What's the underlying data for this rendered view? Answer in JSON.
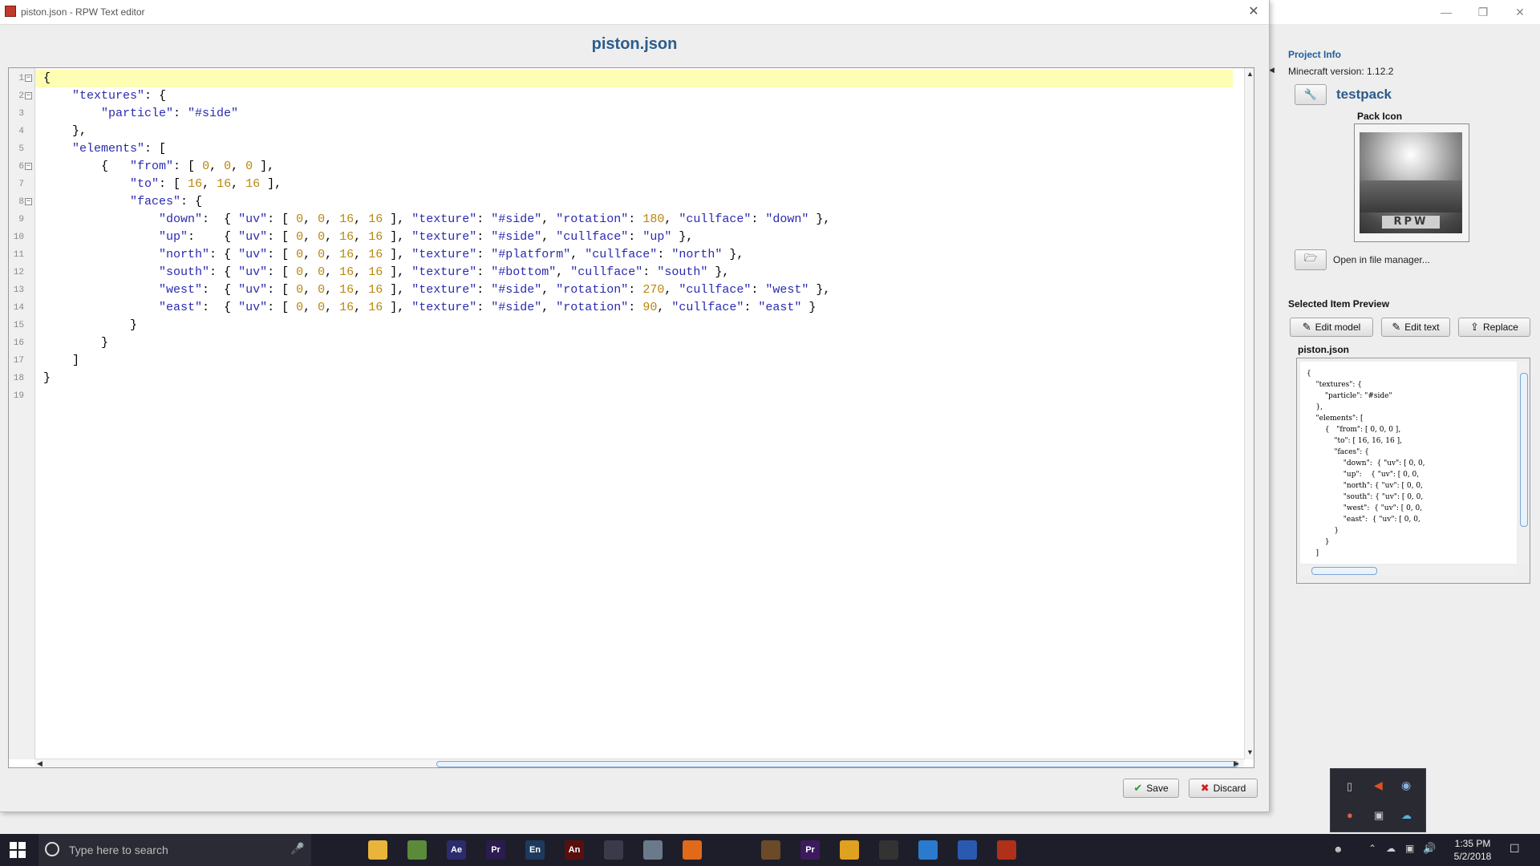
{
  "dialog": {
    "window_title": "piston.json - RPW Text editor",
    "file_name": "piston.json",
    "save_label": "Save",
    "discard_label": "Discard"
  },
  "editor": {
    "lines": [
      {
        "n": "1",
        "fold": true,
        "text": "{"
      },
      {
        "n": "2",
        "fold": true,
        "text": "    \"textures\": {"
      },
      {
        "n": "3",
        "fold": false,
        "text": "        \"particle\": \"#side\""
      },
      {
        "n": "4",
        "fold": false,
        "text": "    },"
      },
      {
        "n": "5",
        "fold": false,
        "text": "    \"elements\": ["
      },
      {
        "n": "6",
        "fold": true,
        "text": "        {   \"from\": [ 0, 0, 0 ],"
      },
      {
        "n": "7",
        "fold": false,
        "text": "            \"to\": [ 16, 16, 16 ],"
      },
      {
        "n": "8",
        "fold": true,
        "text": "            \"faces\": {"
      },
      {
        "n": "9",
        "fold": false,
        "text": "                \"down\":  { \"uv\": [ 0, 0, 16, 16 ], \"texture\": \"#side\", \"rotation\": 180, \"cullface\": \"down\" },"
      },
      {
        "n": "10",
        "fold": false,
        "text": "                \"up\":    { \"uv\": [ 0, 0, 16, 16 ], \"texture\": \"#side\", \"cullface\": \"up\" },"
      },
      {
        "n": "11",
        "fold": false,
        "text": "                \"north\": { \"uv\": [ 0, 0, 16, 16 ], \"texture\": \"#platform\", \"cullface\": \"north\" },"
      },
      {
        "n": "12",
        "fold": false,
        "text": "                \"south\": { \"uv\": [ 0, 0, 16, 16 ], \"texture\": \"#bottom\", \"cullface\": \"south\" },"
      },
      {
        "n": "13",
        "fold": false,
        "text": "                \"west\":  { \"uv\": [ 0, 0, 16, 16 ], \"texture\": \"#side\", \"rotation\": 270, \"cullface\": \"west\" },"
      },
      {
        "n": "14",
        "fold": false,
        "text": "                \"east\":  { \"uv\": [ 0, 0, 16, 16 ], \"texture\": \"#side\", \"rotation\": 90, \"cullface\": \"east\" }"
      },
      {
        "n": "15",
        "fold": false,
        "text": "            }"
      },
      {
        "n": "16",
        "fold": false,
        "text": "        }"
      },
      {
        "n": "17",
        "fold": false,
        "text": "    ]"
      },
      {
        "n": "18",
        "fold": false,
        "text": "}"
      },
      {
        "n": "19",
        "fold": false,
        "text": ""
      }
    ],
    "active_line": "1"
  },
  "project": {
    "heading": "Project Info",
    "mc_version": "Minecraft version: 1.12.2",
    "pack_name": "testpack",
    "pack_icon_label": "Pack Icon",
    "pack_icon_text": "RPW",
    "open_in_fm": "Open in file manager...",
    "preview_heading": "Selected Item Preview",
    "edit_model": "Edit model",
    "edit_text": "Edit text",
    "replace": "Replace",
    "preview_file": "piston.json",
    "preview_lines": [
      "{",
      "    \"textures\": {",
      "        \"particle\": \"#side\"",
      "    },",
      "    \"elements\": [",
      "        {   \"from\": [ 0, 0, 0 ],",
      "            \"to\": [ 16, 16, 16 ],",
      "            \"faces\": {",
      "                \"down\":  { \"uv\": [ 0, 0,",
      "                \"up\":    { \"uv\": [ 0, 0,",
      "                \"north\": { \"uv\": [ 0, 0,",
      "                \"south\": { \"uv\": [ 0, 0,",
      "                \"west\":  { \"uv\": [ 0, 0,",
      "                \"east\":  { \"uv\": [ 0, 0,",
      "            }",
      "        }",
      "    ]"
    ]
  },
  "taskbar": {
    "search_placeholder": "Type here to search",
    "time": "1:35 PM",
    "date": "5/2/2018",
    "apps": [
      {
        "name": "task-view",
        "label": "",
        "color": "#1e1e2a"
      },
      {
        "name": "file-explorer",
        "label": "",
        "color": "#e8b53a"
      },
      {
        "name": "minecraft",
        "label": "",
        "color": "#5b8a3a"
      },
      {
        "name": "after-effects",
        "label": "Ae",
        "color": "#2b2b6e"
      },
      {
        "name": "premiere-pro",
        "label": "Pr",
        "color": "#2b1b4e"
      },
      {
        "name": "encore",
        "label": "En",
        "color": "#1d3a5e"
      },
      {
        "name": "animate",
        "label": "An",
        "color": "#5a0f0f"
      },
      {
        "name": "film-editor",
        "label": "",
        "color": "#3a3a4a"
      },
      {
        "name": "photo-viewer",
        "label": "",
        "color": "#6a7a8a"
      },
      {
        "name": "firefox",
        "label": "",
        "color": "#e06a1a"
      },
      {
        "name": "monitor-app",
        "label": "",
        "color": "#1e1e2a"
      },
      {
        "name": "game-app",
        "label": "",
        "color": "#6b4a2a"
      },
      {
        "name": "premiere-rush",
        "label": "Pr",
        "color": "#3d1a5e"
      },
      {
        "name": "fl-studio",
        "label": "",
        "color": "#e0a020"
      },
      {
        "name": "obs",
        "label": "",
        "color": "#333"
      },
      {
        "name": "chat-app",
        "label": "",
        "color": "#2a7ad0"
      },
      {
        "name": "notepad-app",
        "label": "",
        "color": "#2a5ab0"
      },
      {
        "name": "rpw-app",
        "label": "",
        "color": "#b0301a"
      }
    ]
  },
  "colors": {
    "accent_title": "#2c5c8c",
    "active_line": "#fdfdb4",
    "key_string": "#2a2ab0",
    "number": "#b8860b"
  }
}
